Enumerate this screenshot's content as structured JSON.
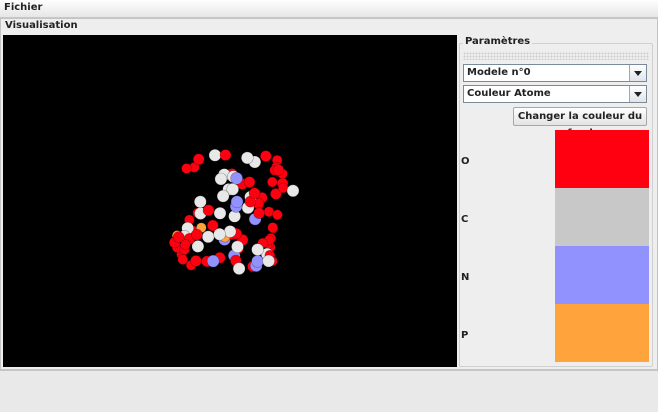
{
  "menubar": {
    "file_label": "Fichier"
  },
  "visualisation": {
    "title": "Visualisation"
  },
  "parametres": {
    "title": "Paramètres",
    "model_select": {
      "value": "Modele n°0"
    },
    "color_mode_select": {
      "value": "Couleur Atome"
    },
    "background_button_label": "Changer la couleur du fond",
    "elements": [
      {
        "symbol": "O",
        "color": "#ff0011"
      },
      {
        "symbol": "C",
        "color": "#c8c8c8"
      },
      {
        "symbol": "N",
        "color": "#9292ff"
      },
      {
        "symbol": "P",
        "color": "#ffa43c"
      }
    ]
  },
  "colors": {
    "viewport_background": "#000000",
    "atom_oxygen": "#ff0011",
    "atom_carbon": "#e8e8e8",
    "atom_nitrogen": "#9292ff",
    "atom_phosphorus": "#ffa43c"
  }
}
